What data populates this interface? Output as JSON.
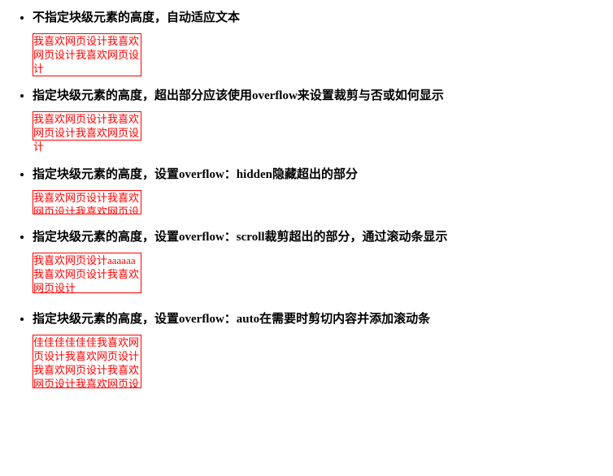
{
  "items": [
    {
      "title": "不指定块级元素的高度，自动适应文本",
      "box_text": "我喜欢网页设计我喜欢网页设计我喜欢网页设计",
      "box_class": "box-auto"
    },
    {
      "title": "指定块级元素的高度，超出部分应该使用overflow来设置裁剪与否或如何显示",
      "box_text": "我喜欢网页设计我喜欢网页设计我喜欢网页设计",
      "box_class": "box-fixed-visible"
    },
    {
      "title": "指定块级元素的高度，设置overflow：hidden隐藏超出的部分",
      "box_text": "我喜欢网页设计我喜欢网页设计我喜欢网页设计",
      "box_class": "box-hidden"
    },
    {
      "title": "指定块级元素的高度，设置overflow：scroll裁剪超出的部分，通过滚动条显示",
      "box_text": "我喜欢网页设计aaaaaa我喜欢网页设计我喜欢网页设计",
      "box_class": "box-scroll"
    },
    {
      "title": "指定块级元素的高度，设置overflow：auto在需要时剪切内容并添加滚动条",
      "box_text": "佳佳佳佳佳佳我喜欢网页设计我喜欢网页设计我喜欢网页设计我喜欢网页设计我喜欢网页设计",
      "box_class": "box-auto-of"
    }
  ]
}
